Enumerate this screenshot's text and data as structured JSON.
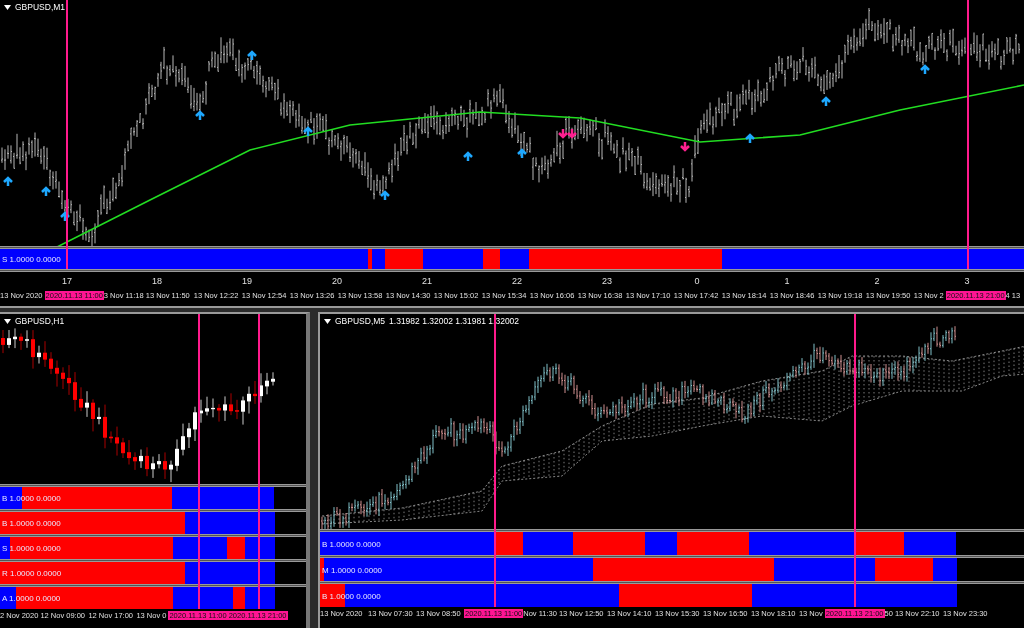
{
  "top_chart": {
    "title": "GBPUSD,M1",
    "indicator": {
      "label": "S 1.0000 0.0000",
      "segments": [
        {
          "color": "#0000ff"
        },
        {
          "color": "#ff0000"
        },
        {
          "color": "#0000ff"
        },
        {
          "color": "#ff0000"
        },
        {
          "color": "#0000ff"
        },
        {
          "color": "#ff0000"
        },
        {
          "color": "#0000ff"
        },
        {
          "color": "#ff0000"
        },
        {
          "color": "#0000ff"
        }
      ]
    },
    "hour_labels": [
      "17",
      "18",
      "19",
      "20",
      "21",
      "22",
      "23",
      "0",
      "1",
      "2",
      "3"
    ],
    "time_axis": [
      {
        "text": "13 Nov 2020",
        "kind": "partial"
      },
      {
        "text": "2020.11.13 11:00",
        "kind": "marker"
      },
      {
        "text": "3 Nov 11:18",
        "kind": "partial"
      },
      {
        "text": "13 Nov 11:50",
        "kind": "tick"
      },
      {
        "text": "13 Nov 12:22",
        "kind": "tick"
      },
      {
        "text": "13 Nov 12:54",
        "kind": "tick"
      },
      {
        "text": "13 Nov 13:26",
        "kind": "tick"
      },
      {
        "text": "13 Nov 13:58",
        "kind": "tick"
      },
      {
        "text": "13 Nov 14:30",
        "kind": "tick"
      },
      {
        "text": "13 Nov 15:02",
        "kind": "tick"
      },
      {
        "text": "13 Nov 15:34",
        "kind": "tick"
      },
      {
        "text": "13 Nov 16:06",
        "kind": "tick"
      },
      {
        "text": "13 Nov 16:38",
        "kind": "tick"
      },
      {
        "text": "13 Nov 17:10",
        "kind": "tick"
      },
      {
        "text": "13 Nov 17:42",
        "kind": "tick"
      },
      {
        "text": "13 Nov 18:14",
        "kind": "tick"
      },
      {
        "text": "13 Nov 18:46",
        "kind": "tick"
      },
      {
        "text": "13 Nov 19:18",
        "kind": "tick"
      },
      {
        "text": "13 Nov 19:50",
        "kind": "tick"
      },
      {
        "text": "13 Nov 2",
        "kind": "partial"
      },
      {
        "text": "2020.11.13 21:00",
        "kind": "marker"
      },
      {
        "text": "4",
        "kind": "partial"
      },
      {
        "text": "13",
        "kind": "partial"
      }
    ]
  },
  "h1_chart": {
    "title": "GBPUSD,H1",
    "indicators": [
      {
        "label": "B 1.0000 0.0000",
        "segments": [
          {
            "color": "#0000ff"
          },
          {
            "color": "#ff0000"
          },
          {
            "color": "#0000ff"
          }
        ]
      },
      {
        "label": "B 1.0000 0.0000",
        "segments": [
          {
            "color": "#ff0000"
          },
          {
            "color": "#0000ff"
          }
        ]
      },
      {
        "label": "S 1.0000 0.0000",
        "segments": [
          {
            "color": "#0000ff"
          },
          {
            "color": "#ff0000"
          },
          {
            "color": "#0000ff"
          },
          {
            "color": "#ff0000"
          },
          {
            "color": "#0000ff"
          }
        ]
      },
      {
        "label": "R 1.0000 0.0000",
        "segments": [
          {
            "color": "#ff0000"
          },
          {
            "color": "#0000ff"
          }
        ]
      },
      {
        "label": "A 1.0000 0.0000",
        "segments": [
          {
            "color": "#0000ff"
          },
          {
            "color": "#ff0000"
          },
          {
            "color": "#0000ff"
          },
          {
            "color": "#ff0000"
          },
          {
            "color": "#0000ff"
          }
        ]
      }
    ],
    "time_axis": [
      {
        "text": "2 Nov 2020",
        "kind": "partial"
      },
      {
        "text": "12 Nov 09:00",
        "kind": "tick"
      },
      {
        "text": "12 Nov 17:00",
        "kind": "tick"
      },
      {
        "text": "13 Nov 0",
        "kind": "partial"
      },
      {
        "text": "2020.11.13 11:00",
        "kind": "marker"
      },
      {
        "text": "2020.11.13 21:00",
        "kind": "marker"
      }
    ]
  },
  "m5_chart": {
    "title": "GBPUSD,M5",
    "quote": "1.31982 1.32002 1.31981 1.32002",
    "indicators": [
      {
        "label": "B 1.0000 0.0000",
        "segments": [
          {
            "color": "#0000ff"
          },
          {
            "color": "#ff0000"
          },
          {
            "color": "#0000ff"
          },
          {
            "color": "#ff0000"
          },
          {
            "color": "#0000ff"
          },
          {
            "color": "#ff0000"
          },
          {
            "color": "#0000ff"
          },
          {
            "color": "#ff0000"
          },
          {
            "color": "#0000ff"
          }
        ]
      },
      {
        "label": "M 1.0000 0.0000",
        "segments": [
          {
            "color": "#ff0000"
          },
          {
            "color": "#0000ff"
          },
          {
            "color": "#ff0000"
          },
          {
            "color": "#0000ff"
          },
          {
            "color": "#ff0000"
          },
          {
            "color": "#0000ff"
          }
        ]
      },
      {
        "label": "B 1.0000 0.0000",
        "segments": [
          {
            "color": "#ff0000"
          },
          {
            "color": "#0000ff"
          },
          {
            "color": "#ff0000"
          },
          {
            "color": "#0000ff"
          }
        ]
      }
    ],
    "time_axis": [
      {
        "text": "13 Nov 2020",
        "kind": "tick"
      },
      {
        "text": "13 Nov 07:30",
        "kind": "tick"
      },
      {
        "text": "13 Nov 08:50",
        "kind": "tick"
      },
      {
        "text": "2020.11.13 11:00",
        "kind": "marker"
      },
      {
        "text": "Nov 11:30",
        "kind": "partial"
      },
      {
        "text": "13 Nov 12:50",
        "kind": "tick"
      },
      {
        "text": "13 Nov 14:10",
        "kind": "tick"
      },
      {
        "text": "13 Nov 15:30",
        "kind": "tick"
      },
      {
        "text": "13 Nov 16:50",
        "kind": "tick"
      },
      {
        "text": "13 Nov 18:10",
        "kind": "tick"
      },
      {
        "text": "13 Nov",
        "kind": "partial"
      },
      {
        "text": "2020.11.13 21:00",
        "kind": "marker"
      },
      {
        "text": "50",
        "kind": "partial"
      },
      {
        "text": "13 Nov 22:10",
        "kind": "tick"
      },
      {
        "text": "13 Nov 23:30",
        "kind": "tick"
      }
    ]
  }
}
